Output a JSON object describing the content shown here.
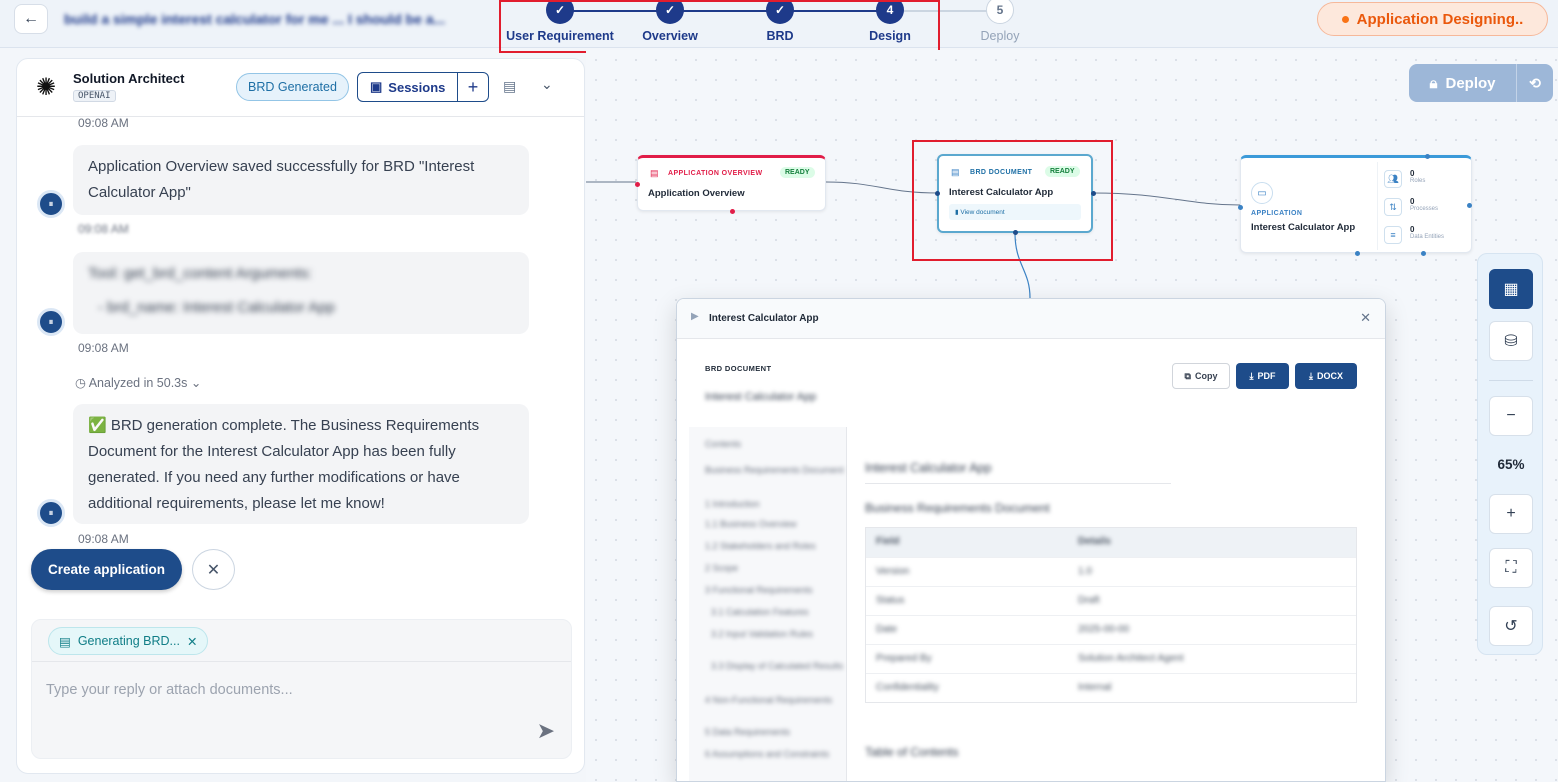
{
  "header": {
    "back_icon": "arrow-left-icon",
    "project_title": "build a simple interest calculator for me ... I should be a...",
    "steps": [
      {
        "number": "✓",
        "label": "User Requirement",
        "state": "done"
      },
      {
        "number": "✓",
        "label": "Overview",
        "state": "done"
      },
      {
        "number": "✓",
        "label": "BRD",
        "state": "done"
      },
      {
        "number": "4",
        "label": "Design",
        "state": "current"
      },
      {
        "number": "5",
        "label": "Deploy",
        "state": "future"
      }
    ],
    "status": "Application Designing.."
  },
  "chat": {
    "agent_name": "Solution Architect",
    "agent_provider": "OPENAI",
    "brd_badge": "BRD Generated",
    "sessions_label": "Sessions",
    "sessions_add": "+",
    "messages": [
      {
        "time_top": "09:08 AM",
        "text": "Application Overview saved successfully for BRD \"Interest Calculator App\"",
        "time": "09:08 AM"
      },
      {
        "text_line1": "Tool: get_brd_content Arguments:",
        "text_line2": "- brd_name: Interest Calculator App",
        "time": "09:08 AM"
      },
      {
        "analyzed": "Analyzed in 50.3s",
        "text": "✅ BRD generation complete. The Business Requirements Document for the Interest Calculator App has been fully generated. If you need any further modifications or have additional requirements, please let me know!",
        "time": "09:08 AM"
      }
    ],
    "create_button": "Create application",
    "close_icon": "x-icon",
    "attachment_chip": "Generating BRD...",
    "input_placeholder": "Type your reply or attach documents...",
    "send_icon": "send-icon"
  },
  "canvas": {
    "deploy_button": "Deploy",
    "nodes": {
      "overview": {
        "type": "APPLICATION OVERVIEW",
        "status": "READY",
        "title": "Application Overview"
      },
      "brd": {
        "type": "BRD DOCUMENT",
        "status": "READY",
        "title": "Interest Calculator App",
        "link": "View document"
      },
      "app": {
        "type": "APPLICATION",
        "title": "Interest Calculator App",
        "roles_count": "0",
        "roles_label": "Roles",
        "processes_count": "0",
        "processes_label": "Processes",
        "entities_count": "0",
        "entities_label": "Data Entities"
      }
    },
    "zoom_level": "65%"
  },
  "modal": {
    "title": "Interest Calculator App",
    "doc_label": "BRD DOCUMENT",
    "doc_subtitle": "Interest Calculator App",
    "copy_label": "Copy",
    "pdf_label": "PDF",
    "docx_label": "DOCX",
    "toc": [
      "Contents",
      "Business Requirements Document",
      "1 Introduction",
      "1.1 Business Overview",
      "1.2 Stakeholders and Roles",
      "2 Scope",
      "3 Functional Requirements",
      "3.1 Calculation Features",
      "3.2 Input Validation Rules",
      "3.3 Display of Calculated Results",
      "4 Non-Functional Requirements",
      "5 Data Requirements",
      "6 Assumptions and Constraints"
    ],
    "doc_heading": "Interest Calculator App",
    "doc_subheading": "Business Requirements Document",
    "table_head": [
      "Field",
      "Details"
    ],
    "table_rows": [
      [
        "Version",
        "1.0"
      ],
      [
        "Status",
        "Draft"
      ],
      [
        "Date",
        "2025-00-00"
      ],
      [
        "Prepared By",
        "Solution Architect Agent"
      ],
      [
        "Confidentiality",
        "Internal"
      ]
    ],
    "next_section": "Table of Contents"
  }
}
